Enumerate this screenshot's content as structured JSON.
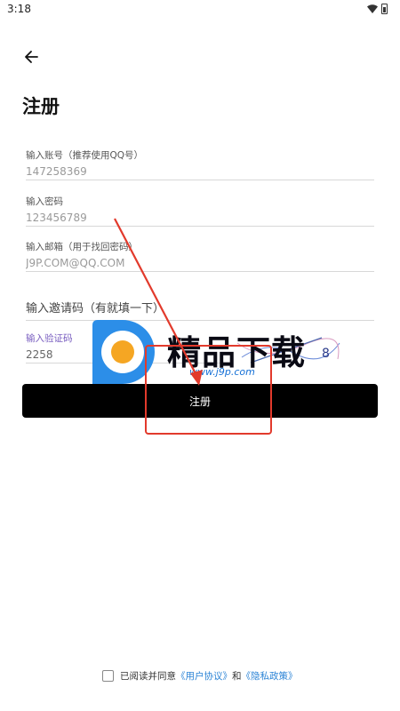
{
  "status_bar": {
    "time": "3:18"
  },
  "page": {
    "title": "注册"
  },
  "fields": {
    "account": {
      "label": "输入账号（推荐使用QQ号）",
      "value": "147258369"
    },
    "password": {
      "label": "输入密码",
      "value": "123456789"
    },
    "email": {
      "label": "输入邮箱（用于找回密码）",
      "value": "J9P.COM@QQ.COM"
    },
    "invite": {
      "placeholder": "输入邀请码（有就填一下）"
    },
    "captcha": {
      "label": "输入验证码",
      "value": "2258",
      "image_text": "8"
    }
  },
  "register_button": {
    "label": "注册"
  },
  "agreement": {
    "prefix": "已阅读并同意",
    "user_agreement": "《用户协议》",
    "conjunction": "和",
    "privacy_policy": "《隐私政策》"
  },
  "watermark": {
    "name": "精品下载",
    "url": "www.j9p.com"
  },
  "colors": {
    "accent": "#7a5fc0",
    "button_bg": "#000000",
    "link": "#2c84d6",
    "annotation": "#e23a2c"
  },
  "icons": {
    "back": "arrow-left-icon",
    "wifi": "wifi-icon",
    "battery": "battery-icon",
    "checkbox": "checkbox-unchecked"
  }
}
